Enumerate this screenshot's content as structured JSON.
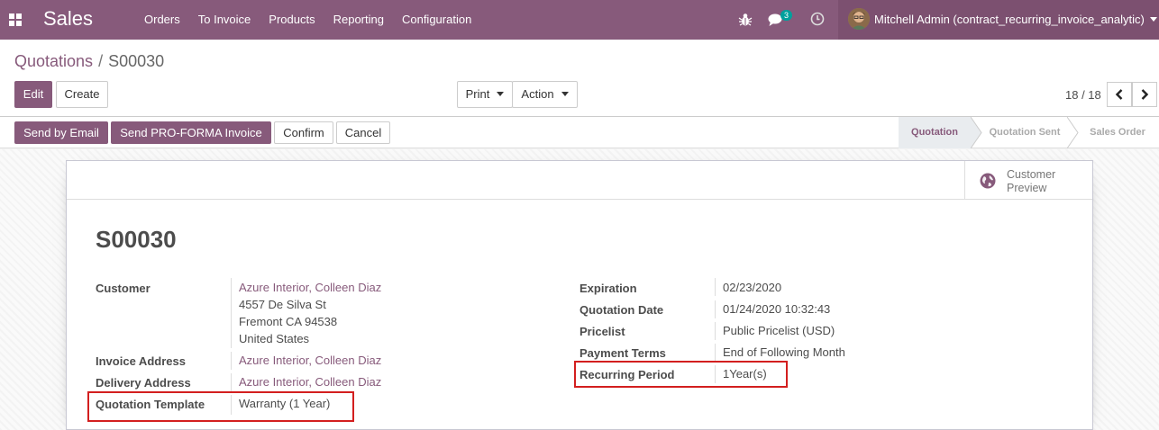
{
  "navbar": {
    "brand": "Sales",
    "menu": [
      "Orders",
      "To Invoice",
      "Products",
      "Reporting",
      "Configuration"
    ],
    "chat_count": "3",
    "user": "Mitchell Admin (contract_recurring_invoice_analytic)"
  },
  "breadcrumb": {
    "parent": "Quotations",
    "separator": "/",
    "current": "S00030"
  },
  "buttons": {
    "edit": "Edit",
    "create": "Create",
    "print": "Print",
    "action": "Action"
  },
  "pager": "18 / 18",
  "statusbar": {
    "send_email": "Send by Email",
    "send_proforma": "Send PRO-FORMA Invoice",
    "confirm": "Confirm",
    "cancel": "Cancel",
    "stages": [
      "Quotation",
      "Quotation Sent",
      "Sales Order"
    ],
    "active_stage": "Quotation"
  },
  "smart_button": {
    "line1": "Customer",
    "line2": "Preview"
  },
  "record": {
    "name": "S00030",
    "left": {
      "customer_label": "Customer",
      "customer_name": "Azure Interior, Colleen Diaz",
      "customer_address": [
        "4557 De Silva St",
        "Fremont CA 94538",
        "United States"
      ],
      "invoice_label": "Invoice Address",
      "invoice_value": "Azure Interior, Colleen Diaz",
      "delivery_label": "Delivery Address",
      "delivery_value": "Azure Interior, Colleen Diaz",
      "template_label": "Quotation Template",
      "template_value": "Warranty (1 Year)"
    },
    "right": {
      "expiration_label": "Expiration",
      "expiration_value": "02/23/2020",
      "qdate_label": "Quotation Date",
      "qdate_value": "01/24/2020 10:32:43",
      "pricelist_label": "Pricelist",
      "pricelist_value": "Public Pricelist (USD)",
      "terms_label": "Payment Terms",
      "terms_value": "End of Following Month",
      "recurring_label": "Recurring Period",
      "recurring_value": "1Year(s)"
    }
  },
  "colors": {
    "brand": "#875a7b",
    "highlight": "#d31f1f"
  }
}
